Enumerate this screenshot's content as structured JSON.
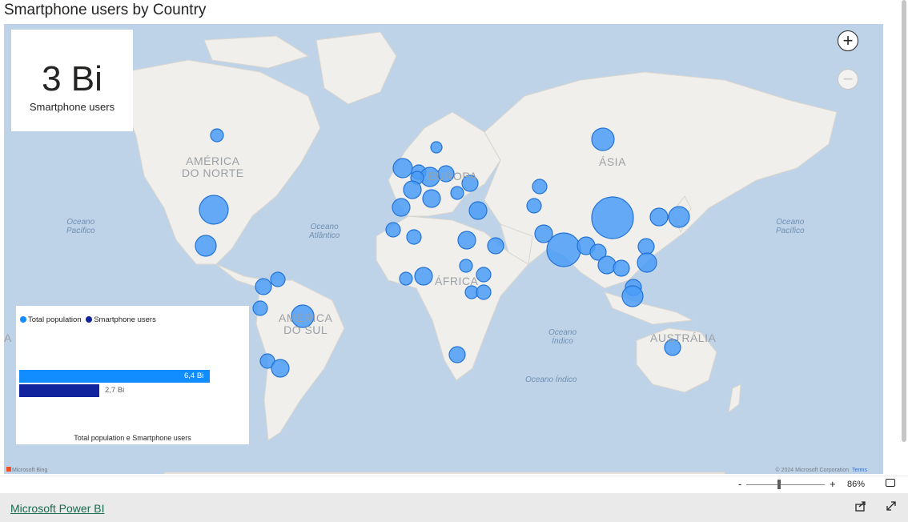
{
  "title": "Smartphone users by Country",
  "kpi": {
    "value": "3 Bi",
    "label": "Smartphone users"
  },
  "map": {
    "continents": [
      "AMÉRICA\nDO NORTE",
      "EUROPA",
      "ÁSIA",
      "ÁFRICA",
      "AMÉRICA\nDO SUL",
      "AUSTRÁLIA",
      "A"
    ],
    "oceans": [
      "Oceano\nPacífico",
      "Oceano\nAtlântico",
      "Oceano\nÍndico",
      "Oceano Índico",
      "Oceano\nPacífico"
    ],
    "attribution_left": "Microsoft Bing",
    "attribution_right": "© 2024 Microsoft Corporation",
    "terms": "Terms",
    "zoom_in_icon": "plus-icon",
    "zoom_out_icon": "minus-icon",
    "bubble_color": "#4a9cf7"
  },
  "legend": {
    "items": [
      {
        "label": "Total population",
        "color": "#118dff"
      },
      {
        "label": "Smartphone users",
        "color": "#12239e"
      }
    ]
  },
  "chart_data": {
    "type": "bar",
    "orientation": "horizontal",
    "series": [
      {
        "name": "Total population",
        "values": [
          6.4
        ],
        "label": "6,4 Bi",
        "color": "#118dff"
      },
      {
        "name": "Smartphone users",
        "values": [
          2.7
        ],
        "label": "2,7 Bi",
        "color": "#12239e"
      }
    ],
    "xlabel": "Total population e Smartphone users",
    "xlim": [
      0,
      7
    ],
    "legend_position": "top-left"
  },
  "zoom": {
    "minus": "-",
    "plus": "+",
    "level": "86%"
  },
  "footer": {
    "link": "Microsoft Power BI",
    "share_icon": "share-icon",
    "expand_icon": "expand-icon"
  }
}
